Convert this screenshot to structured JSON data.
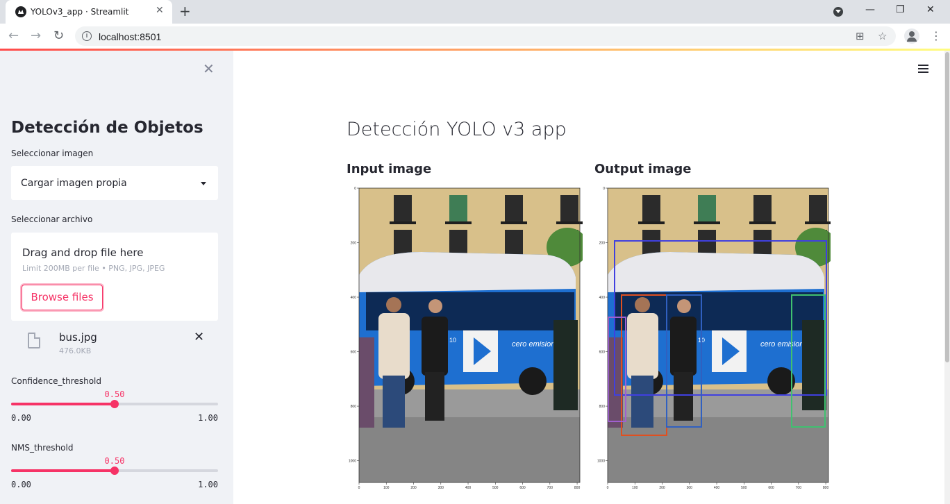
{
  "browser": {
    "tab_title": "YOLOv3_app · Streamlit",
    "url": "localhost:8501"
  },
  "sidebar": {
    "title": "Detección de Objetos",
    "select_label": "Seleccionar imagen",
    "select_value": "Cargar imagen propia",
    "file_label": "Seleccionar archivo",
    "dropzone_title": "Drag and drop file here",
    "dropzone_limit": "Limit 200MB per file • PNG, JPG, JPEG",
    "browse_label": "Browse files",
    "file_name": "bus.jpg",
    "file_size": "476.0KB",
    "confidence": {
      "label": "Confidence_threshold",
      "value": "0.50",
      "fraction": 0.5,
      "min": "0.00",
      "max": "1.00"
    },
    "nms": {
      "label": "NMS_threshold",
      "value": "0.50",
      "fraction": 0.5,
      "min": "0.00",
      "max": "1.00"
    }
  },
  "main": {
    "title": "Detección YOLO v3 app",
    "input_heading": "Input image",
    "output_heading": "Output image",
    "y_ticks": [
      "0",
      "200",
      "400",
      "600",
      "800",
      "1000"
    ],
    "x_ticks": [
      "0",
      "100",
      "200",
      "300",
      "400",
      "500",
      "600",
      "700",
      "800"
    ],
    "bus_text": "cero emisiones",
    "bus_number": "10"
  },
  "colors": {
    "accent": "#f63366",
    "sidebar_bg": "#f0f2f6",
    "text": "#262730",
    "box_bus": "#4040e0",
    "box_person_red": "#e05020",
    "box_person_blue": "#3060c0",
    "box_person_green": "#40c070",
    "box_person_purple": "#a060d0"
  }
}
